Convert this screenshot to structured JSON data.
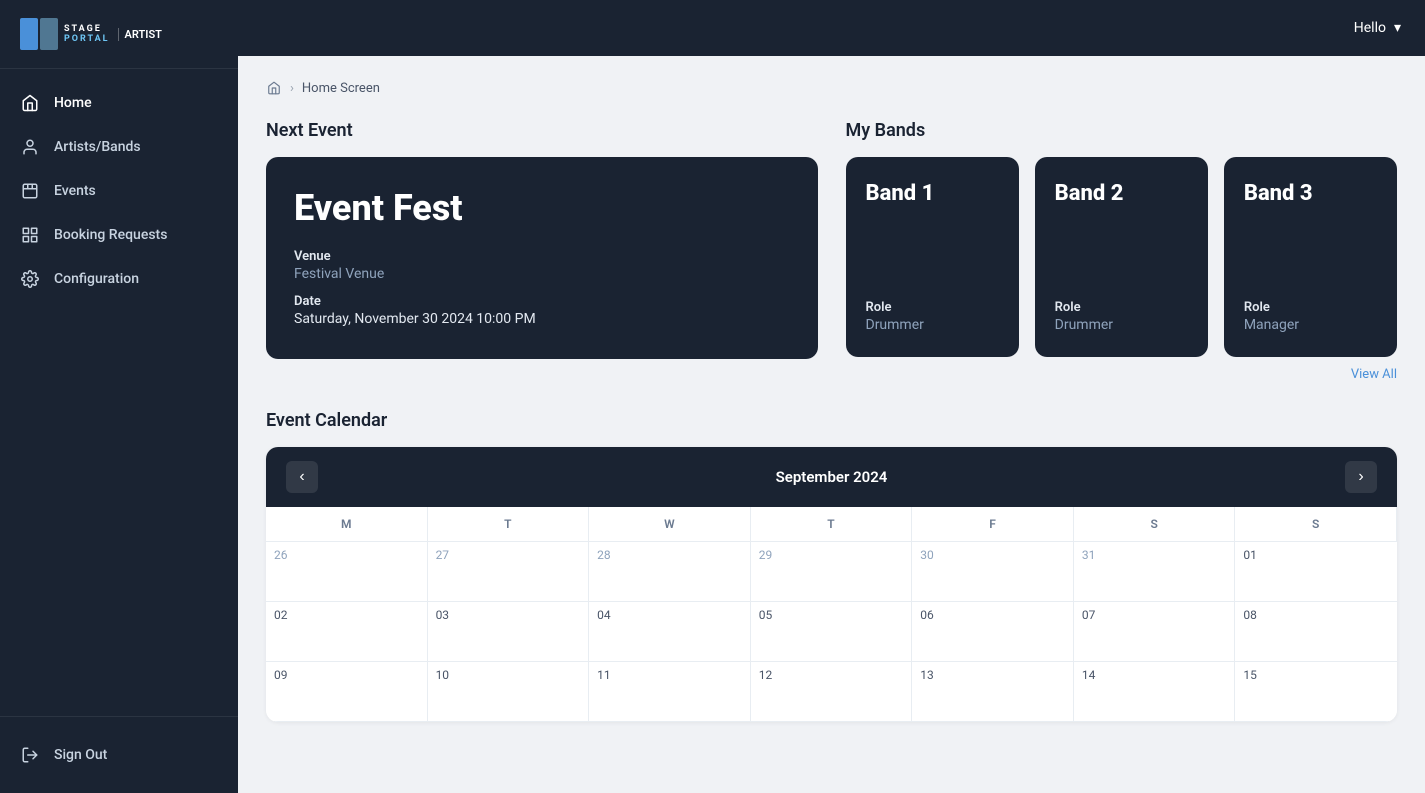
{
  "app": {
    "logo_part1": "STAGE",
    "logo_sep": "PORTAL",
    "logo_part2": "ARTIST"
  },
  "topbar": {
    "user_greeting": "Hello",
    "dropdown_icon": "▾"
  },
  "sidebar": {
    "nav_items": [
      {
        "id": "home",
        "label": "Home",
        "icon": "home",
        "active": true
      },
      {
        "id": "artists-bands",
        "label": "Artists/Bands",
        "icon": "user",
        "active": false
      },
      {
        "id": "events",
        "label": "Events",
        "icon": "calendar-list",
        "active": false
      },
      {
        "id": "booking-requests",
        "label": "Booking Requests",
        "icon": "grid",
        "active": false
      },
      {
        "id": "configuration",
        "label": "Configuration",
        "icon": "gear",
        "active": false
      }
    ],
    "sign_out_label": "Sign Out"
  },
  "breadcrumb": {
    "home_title": "Home",
    "separator": "›",
    "current": "Home Screen"
  },
  "next_event": {
    "section_title": "Next Event",
    "event_name": "Event Fest",
    "venue_label": "Venue",
    "venue_value": "Festival Venue",
    "date_label": "Date",
    "date_value": "Saturday, November 30 2024 10:00 PM"
  },
  "my_bands": {
    "section_title": "My Bands",
    "view_all": "View All",
    "bands": [
      {
        "name": "Band 1",
        "role_label": "Role",
        "role_value": "Drummer"
      },
      {
        "name": "Band 2",
        "role_label": "Role",
        "role_value": "Drummer"
      },
      {
        "name": "Band 3",
        "role_label": "Role",
        "role_value": "Manager"
      }
    ]
  },
  "event_calendar": {
    "section_title": "Event Calendar",
    "month_label": "September 2024",
    "prev_btn": "‹",
    "next_btn": "›",
    "day_headers": [
      "M",
      "T",
      "W",
      "T",
      "F",
      "S",
      "S"
    ],
    "weeks": [
      [
        "26",
        "27",
        "28",
        "29",
        "30",
        "31",
        "01"
      ],
      [
        "02",
        "03",
        "04",
        "05",
        "06",
        "07",
        "08"
      ],
      [
        "09",
        "10",
        "11",
        "12",
        "13",
        "14",
        "15"
      ]
    ],
    "current_month_start_col": 7,
    "prev_month_days": [
      "26",
      "27",
      "28",
      "29",
      "30",
      "31"
    ],
    "next_month_start": "01"
  }
}
